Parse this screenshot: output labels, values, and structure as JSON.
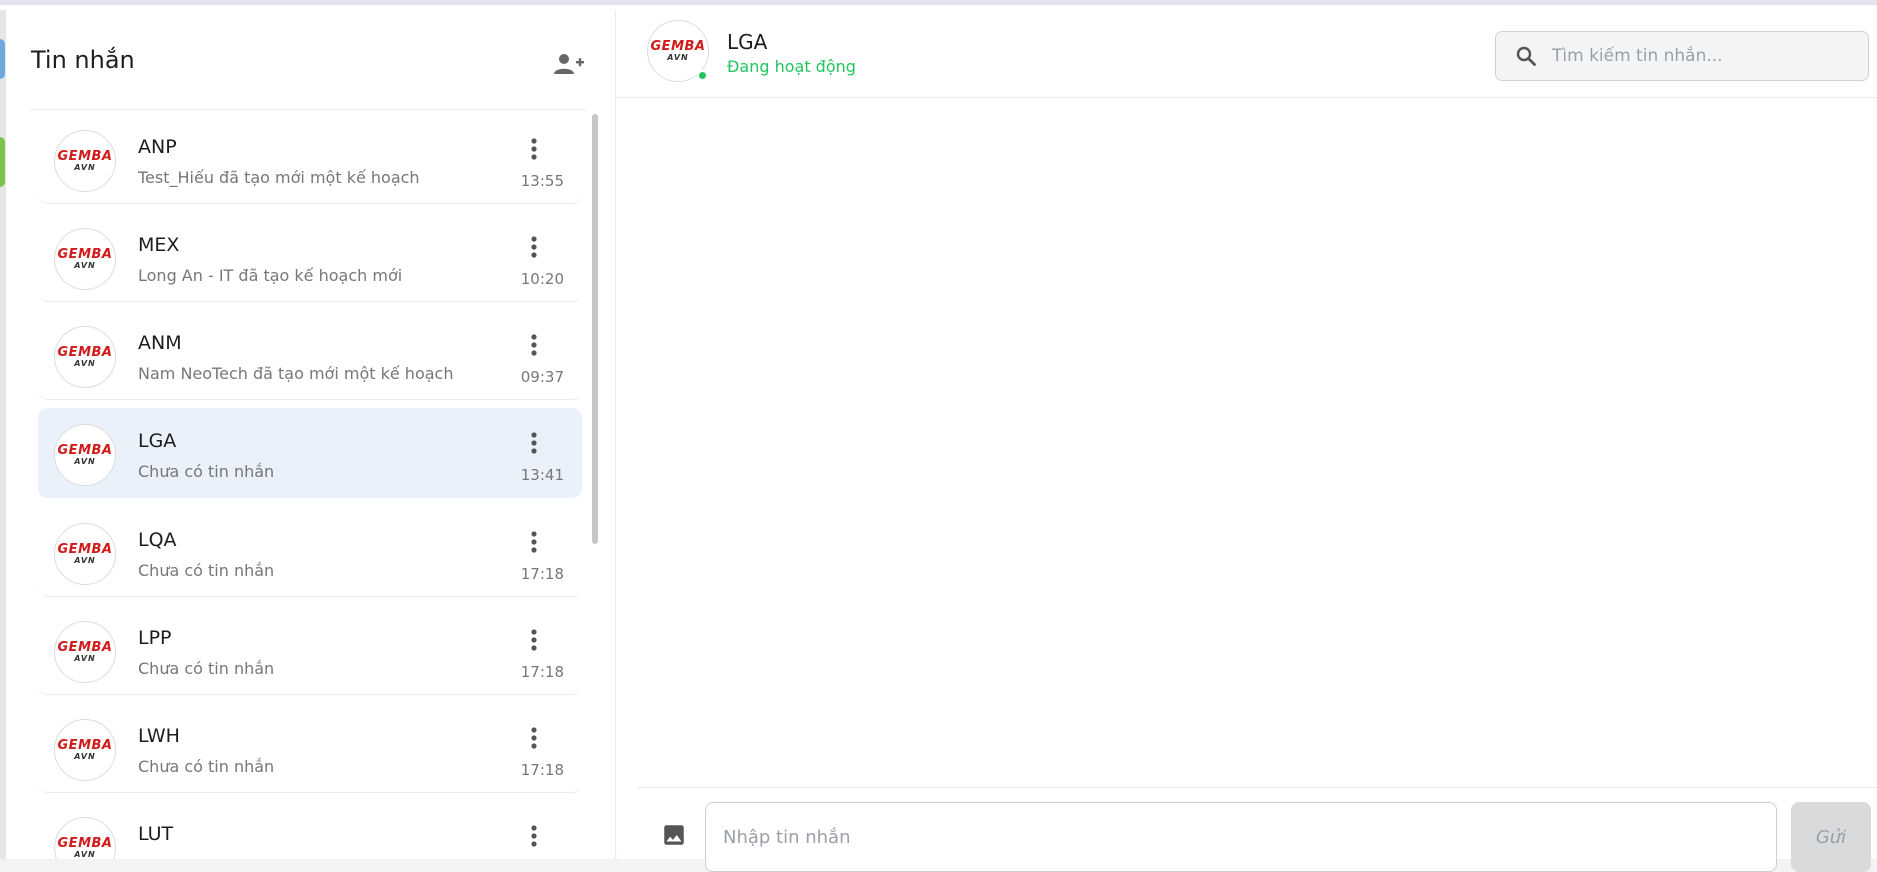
{
  "sidebar": {
    "title": "Tin nhắn",
    "add_user_icon": "person-add-icon",
    "items": [
      {
        "name": "ANP",
        "last_message": "Test_Hiếu đã tạo mới một kế hoạch",
        "time": "13:55",
        "active": false
      },
      {
        "name": "MEX",
        "last_message": "Long An - IT đã tạo kế hoạch mới",
        "time": "10:20",
        "active": false
      },
      {
        "name": "ANM",
        "last_message": "Nam NeoTech đã tạo mới một kế hoạch",
        "time": "09:37",
        "active": false
      },
      {
        "name": "LGA",
        "last_message": "Chưa có tin nhắn",
        "time": "13:41",
        "active": true
      },
      {
        "name": "LQA",
        "last_message": "Chưa có tin nhắn",
        "time": "17:18",
        "active": false
      },
      {
        "name": "LPP",
        "last_message": "Chưa có tin nhắn",
        "time": "17:18",
        "active": false
      },
      {
        "name": "LWH",
        "last_message": "Chưa có tin nhắn",
        "time": "17:18",
        "active": false
      },
      {
        "name": "LUT",
        "last_message": "",
        "time": "",
        "active": false
      }
    ]
  },
  "logo": {
    "main": "GEMBA",
    "sub": "AVN"
  },
  "chat": {
    "name": "LGA",
    "status": "Đang hoạt động",
    "search_placeholder": "Tìm kiếm tin nhắn...",
    "input_placeholder": "Nhập tin nhắn",
    "send_label": "Gửi"
  },
  "colors": {
    "online": "#22c55e",
    "active_row": "#eaf1fb",
    "logo_red": "#d11b1b"
  }
}
